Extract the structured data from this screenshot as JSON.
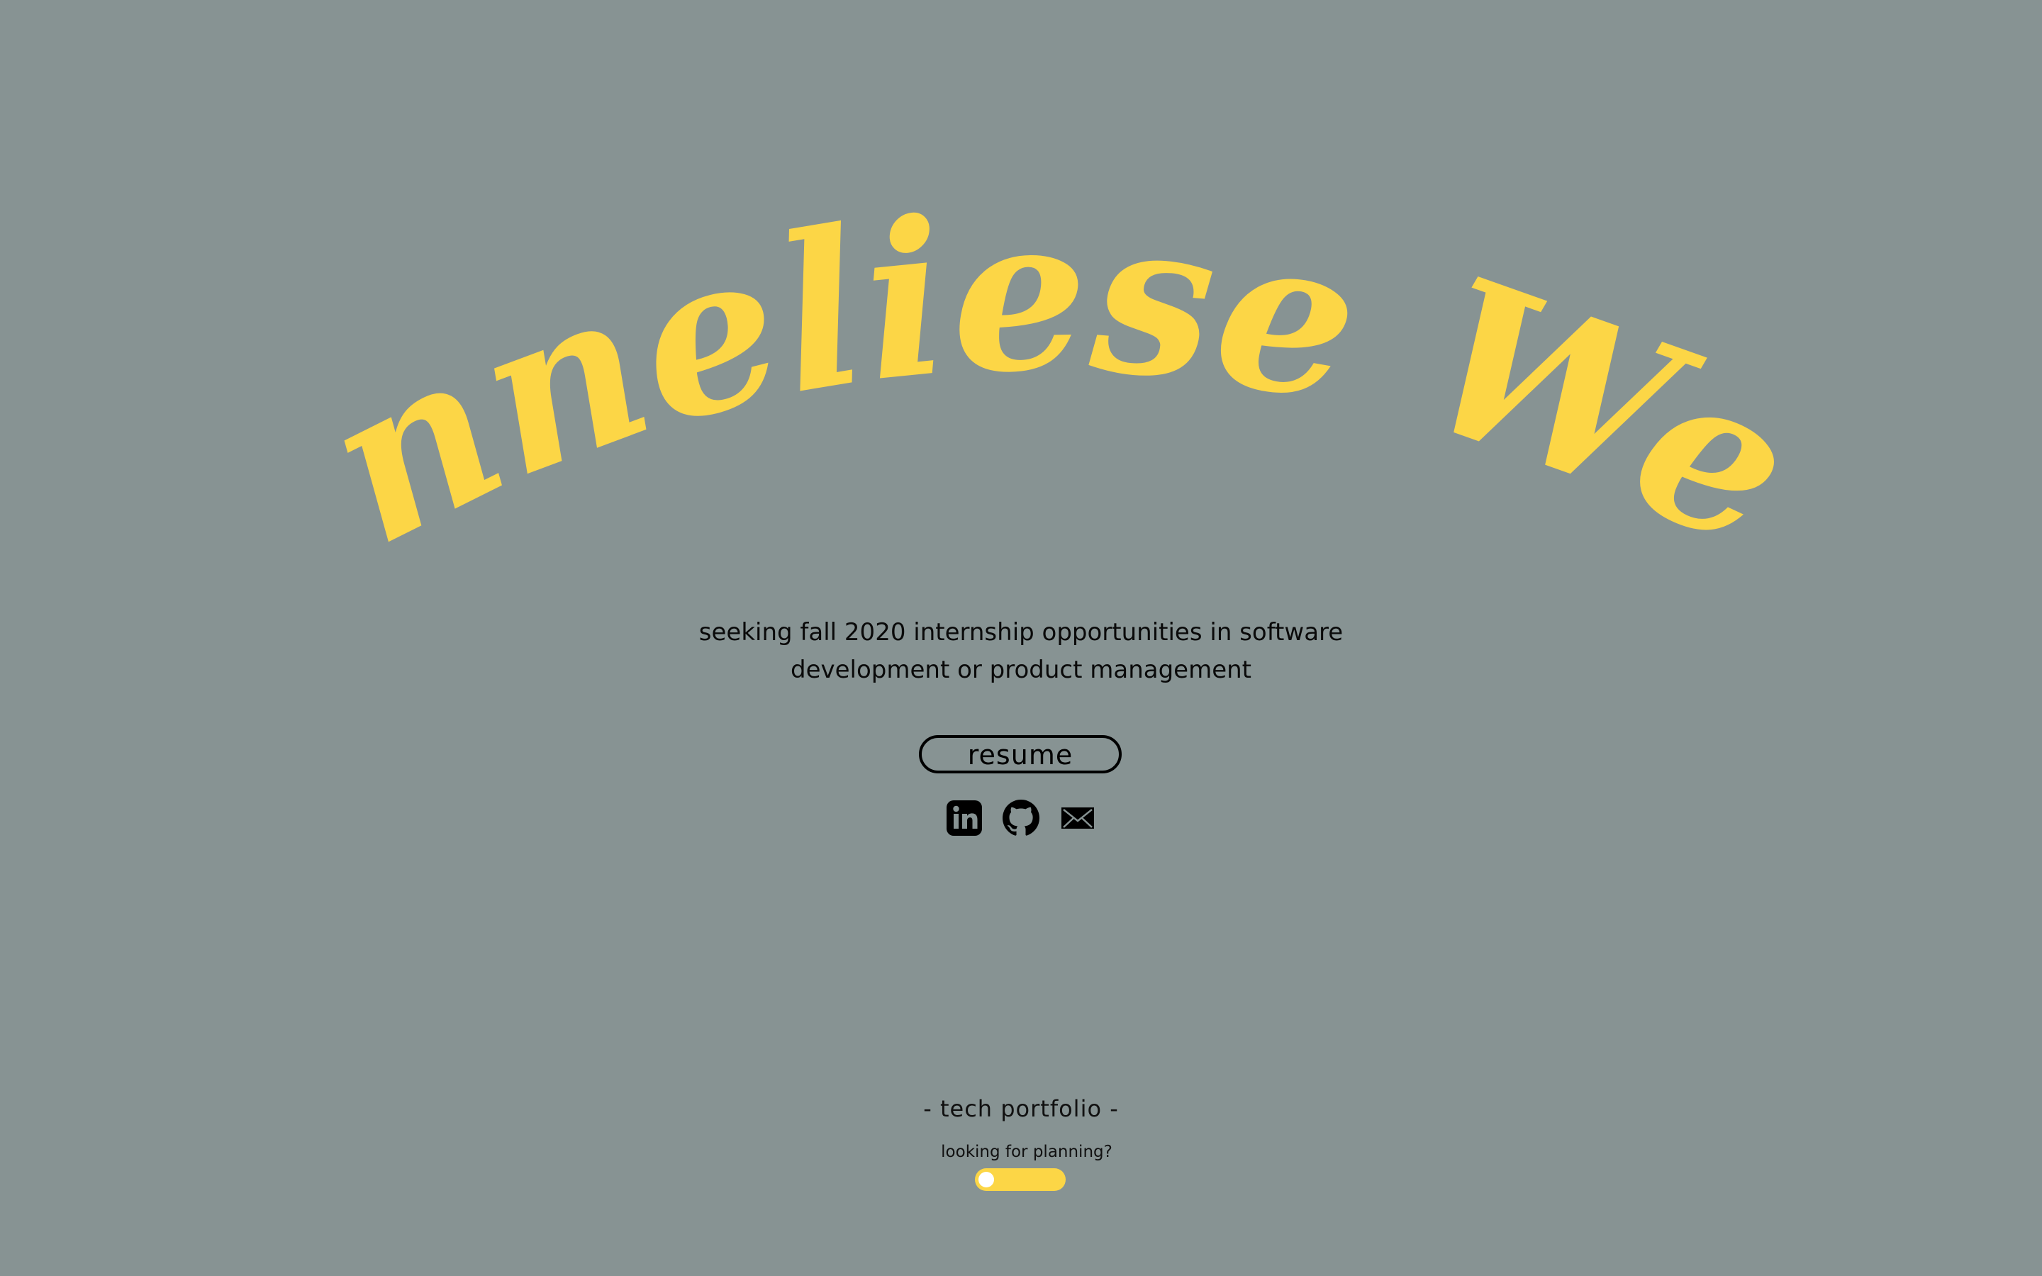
{
  "hero": {
    "name": "Anneliese Wen",
    "name_color": "#FCD646"
  },
  "tagline": {
    "line1": "seeking fall 2020 internship opportunities in software",
    "line2": "development or product management"
  },
  "resume_button": {
    "label": "resume"
  },
  "social_links": [
    {
      "icon": "linkedin-icon"
    },
    {
      "icon": "github-icon"
    },
    {
      "icon": "mail-icon"
    }
  ],
  "footer": {
    "portfolio_label": "- tech portfolio -",
    "toggle_question": "looking for planning?",
    "toggle_state": "off",
    "toggle_color": "#FCD646"
  },
  "colors": {
    "background": "#879393",
    "accent": "#FCD646",
    "text": "#000000"
  }
}
